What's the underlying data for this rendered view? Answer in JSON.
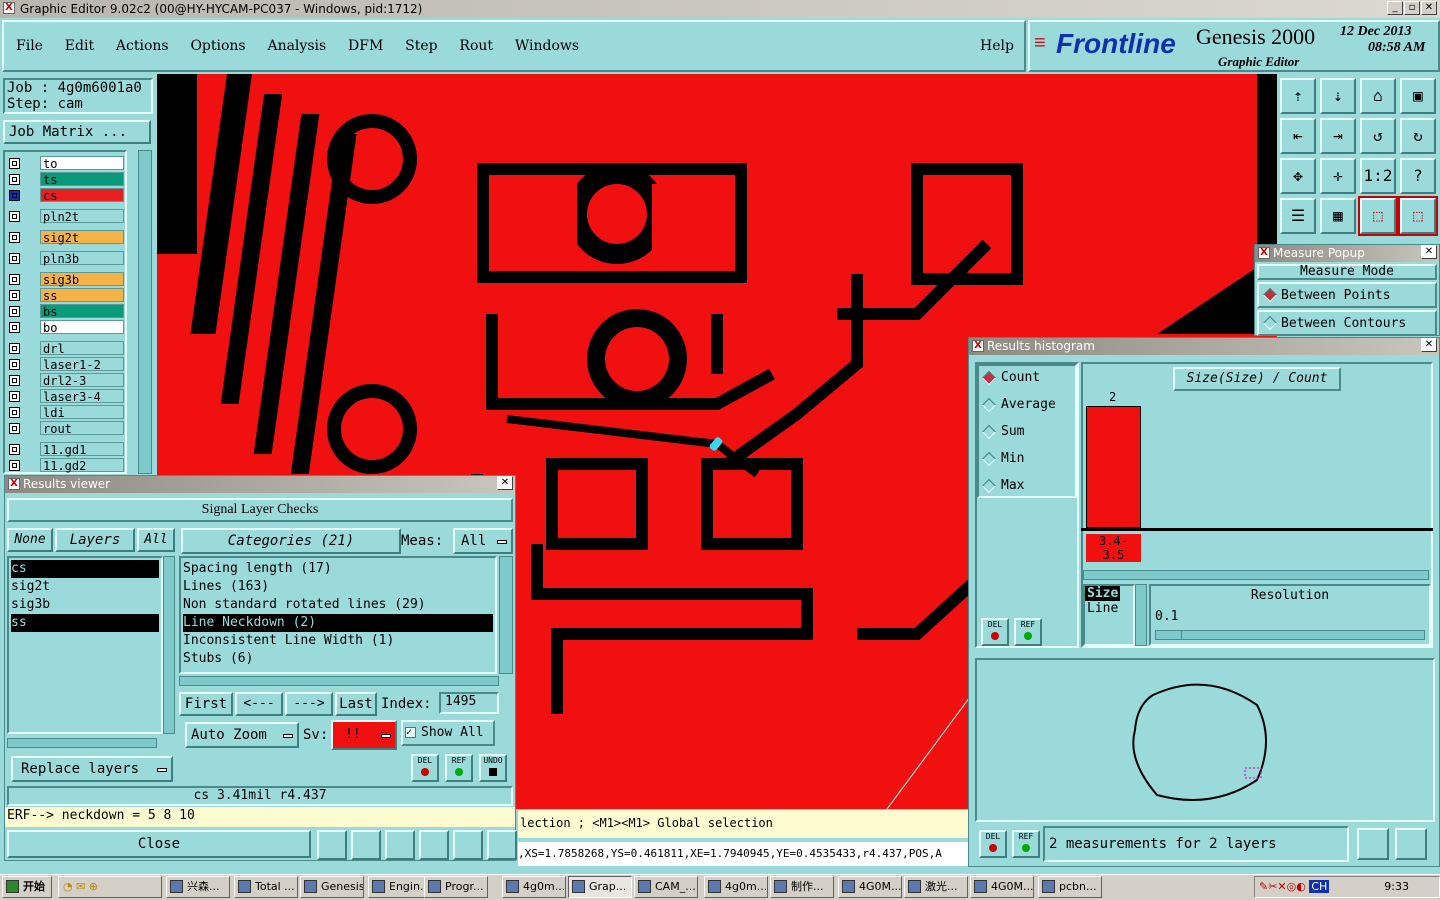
{
  "window": {
    "title": "Graphic Editor 9.02c2 (00@HY-HYCAM-PC037 - Windows, pid:1712)",
    "min": "_",
    "max": "▫",
    "close": "✕"
  },
  "menu": {
    "items": [
      "File",
      "Edit",
      "Actions",
      "Options",
      "Analysis",
      "DFM",
      "Step",
      "Rout",
      "Windows"
    ],
    "help": "Help"
  },
  "brand": {
    "logo": "Frontline",
    "product": "Genesis 2000",
    "sub": "Graphic Editor",
    "date": "12 Dec 2013",
    "time": "08:58 AM"
  },
  "job": {
    "job": "Job : 4g0m6001a0",
    "step": "Step: cam",
    "matrix": "Job Matrix ..."
  },
  "layers": [
    {
      "name": "to",
      "color": "#ffffff"
    },
    {
      "name": "ts",
      "color": "#0a9a7a"
    },
    {
      "name": "cs",
      "color": "#e82020"
    },
    {
      "name": "pln2t",
      "color": "#9adada"
    },
    {
      "name": "sig2t",
      "color": "#f5b347"
    },
    {
      "name": "pln3b",
      "color": "#9adada"
    },
    {
      "name": "sig3b",
      "color": "#f5b347"
    },
    {
      "name": "ss",
      "color": "#f5b347"
    },
    {
      "name": "bs",
      "color": "#0a9a7a"
    },
    {
      "name": "bo",
      "color": "#ffffff"
    },
    {
      "name": "drl",
      "color": "#9adada"
    },
    {
      "name": "laser1-2",
      "color": "#9adada"
    },
    {
      "name": "drl2-3",
      "color": "#9adada"
    },
    {
      "name": "laser3-4",
      "color": "#9adada"
    },
    {
      "name": "ldi",
      "color": "#9adada"
    },
    {
      "name": "rout",
      "color": "#9adada"
    },
    {
      "name": "11.gd1",
      "color": "#9adada"
    },
    {
      "name": "11.gd2",
      "color": "#9adada"
    }
  ],
  "measure": {
    "title": "Measure Popup",
    "mode": "Measure Mode",
    "opt1": "Between Points",
    "opt2": "Between Contours"
  },
  "histogram": {
    "title": "Results histogram",
    "radios": [
      "Count",
      "Average",
      "Sum",
      "Min",
      "Max"
    ],
    "chart_title": "Size(Size) / Count",
    "bar_value": "2",
    "bar_label": "3.4-\n3.5",
    "size_label": "Size",
    "line_label": "Line",
    "resolution": "Resolution",
    "res_value": "0.1",
    "status": "2 measurements for 2 layers"
  },
  "results": {
    "title": "Results viewer",
    "header": "Signal Layer Checks",
    "none": "None",
    "layers": "Layers",
    "all": "All",
    "categories": "Categories (21)",
    "meas": "Meas:",
    "meas_val": "All",
    "layer_list": [
      "cs",
      "sig2t",
      "sig3b",
      "ss"
    ],
    "cat_list": [
      "Spacing length (17)",
      "Lines (163)",
      "Non standard rotated lines (29)",
      "Line Neckdown (2)",
      "Inconsistent Line Width (1)",
      "Stubs (6)"
    ],
    "first": "First",
    "prev": "<---",
    "next": "--->",
    "last": "Last",
    "index_label": "Index:",
    "index_val": "1495",
    "autozoom": "Auto Zoom",
    "sv": "Sv:",
    "sv_val": "!!",
    "showall": "Show All",
    "replace": "Replace layers",
    "del": "DEL",
    "ref": "REF",
    "undo": "UNDO",
    "info": "cs 3.41mil  r4.437",
    "erf": "ERF--> neckdown = 5 8 10",
    "close": "Close"
  },
  "status": {
    "line1": "lection ; <M1><M1> Global selection",
    "line2": ",XS=1.7858268,YS=0.461811,XE=1.7940945,YE=0.4535433,r4.437,POS,A"
  },
  "taskbar": {
    "start": "开始",
    "items": [
      "兴森...",
      "Total ...",
      "Genesis",
      "Engin...",
      "Progr...",
      "4g0m...",
      "Grap...",
      "CAM_...",
      "4g0m...",
      "制作...",
      "4G0M...",
      "激光...",
      "4G0M...",
      "pcbn..."
    ],
    "clock": "9:33",
    "lang": "CH"
  }
}
